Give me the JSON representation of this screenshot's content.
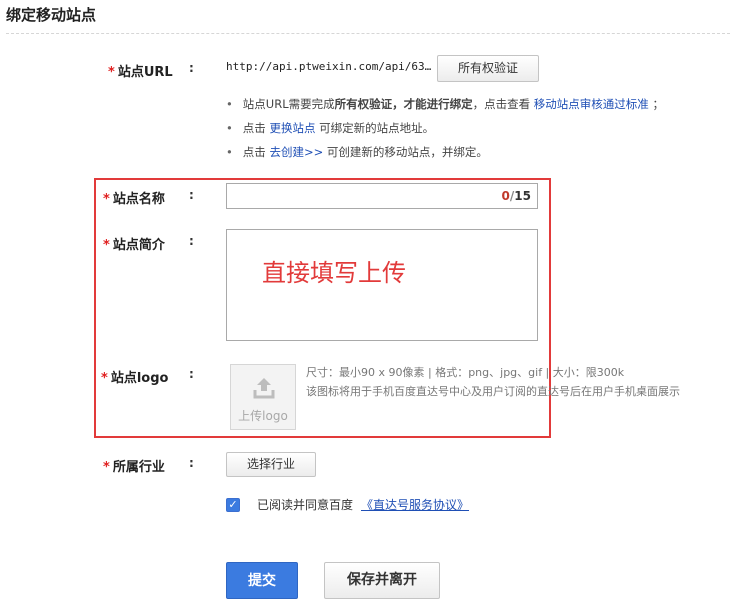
{
  "page": {
    "title": "绑定移动站点"
  },
  "url_row": {
    "label": "站点URL",
    "colon": ":",
    "value": "http://api.ptweixin.com/api/63…",
    "verify_button": "所有权验证"
  },
  "hints": {
    "line1": {
      "prefix": "站点URL需要完成",
      "bold": "所有权验证，才能进行绑定",
      "middle": "，点击查看",
      "link": "移动站点审核通过标准",
      "suffix": "；"
    },
    "line2": {
      "prefix": "点击",
      "link": "更换站点",
      "suffix": "可绑定新的站点地址。"
    },
    "line3": {
      "prefix": "点击",
      "link": "去创建>>",
      "suffix": "可创建新的移动站点，并绑定。"
    }
  },
  "name_row": {
    "label": "站点名称",
    "colon": ":",
    "count_current": "0",
    "count_sep": "/",
    "count_max": "15"
  },
  "intro_row": {
    "label": "站点简介",
    "colon": ":",
    "annotation": "直接填写上传"
  },
  "logo_row": {
    "label": "站点logo",
    "colon": ":",
    "upload_label": "上传logo",
    "spec": "尺寸：最小90 x 90像素 | 格式：png、jpg、gif | 大小：限300k",
    "desc": "该图标将用于手机百度直达号中心及用户订阅的直达号后在用户手机桌面展示"
  },
  "industry_row": {
    "label": "所属行业",
    "colon": ":",
    "select_button": "选择行业"
  },
  "agreement": {
    "text": "已阅读并同意百度",
    "link": "《直达号服务协议》",
    "checked": true
  },
  "actions": {
    "submit": "提交",
    "save_leave": "保存并离开"
  },
  "colors": {
    "primary": "#3b7be0",
    "link": "#1f4fb5",
    "required": "#e02020",
    "annotation": "#e23a3a"
  }
}
